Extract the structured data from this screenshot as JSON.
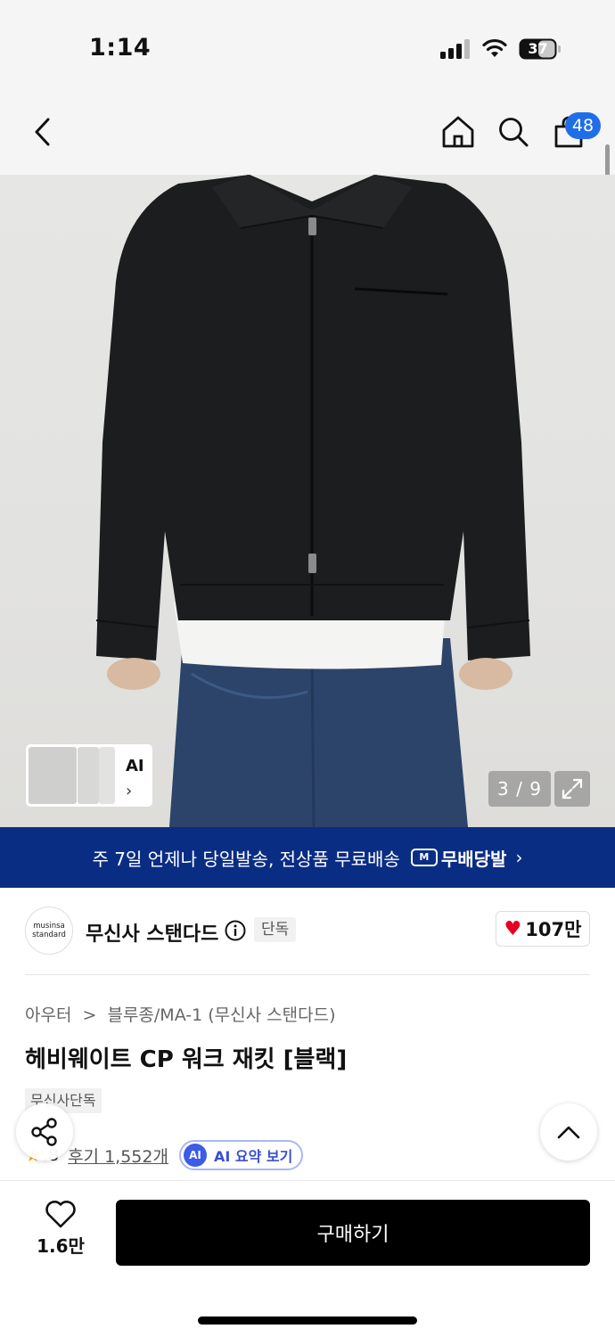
{
  "status_bar": {
    "time": "1:14",
    "battery_level": "37"
  },
  "header": {
    "cart_count": "48"
  },
  "gallery": {
    "ai_label": "AI",
    "ai_chevron": "›",
    "counter": "3 / 9"
  },
  "promo": {
    "text": "주 7일 언제나 당일발송, 전상품 무료배송",
    "logo_mark": "M",
    "logo_text": "무배당발",
    "chevron": "›"
  },
  "brand": {
    "logo_line1": "musinsa",
    "logo_line2": "standard",
    "name": "무신사 스탠다드",
    "tag": "단독",
    "likes": "107만"
  },
  "product": {
    "breadcrumb": [
      "아우터",
      "블루종/MA-1 (무신사 스탠다드)"
    ],
    "breadcrumb_sep": ">",
    "title": "헤비웨이트 CP 워크 재킷 [블랙]",
    "badge": "무신사단독",
    "rating": ".8",
    "reviews": "후기 1,552개",
    "ai_summary": "AI 요약 보기",
    "ai_badge": "AI"
  },
  "bottom_bar": {
    "wish_count": "1.6만",
    "buy_label": "구매하기"
  },
  "colors": {
    "promo_bg": "#0a2d84",
    "cart_badge": "#1f6ee8",
    "heart": "#e60023",
    "buy_button": "#000000",
    "ai_accent": "#3b5be8"
  },
  "icons": {
    "back": "chevron-left-icon",
    "home": "home-icon",
    "search": "search-icon",
    "cart": "shopping-bag-icon",
    "expand": "expand-icon",
    "info": "info-icon",
    "like": "heart-icon",
    "share": "share-icon",
    "top": "chevron-up-icon",
    "wish": "heart-outline-icon"
  }
}
